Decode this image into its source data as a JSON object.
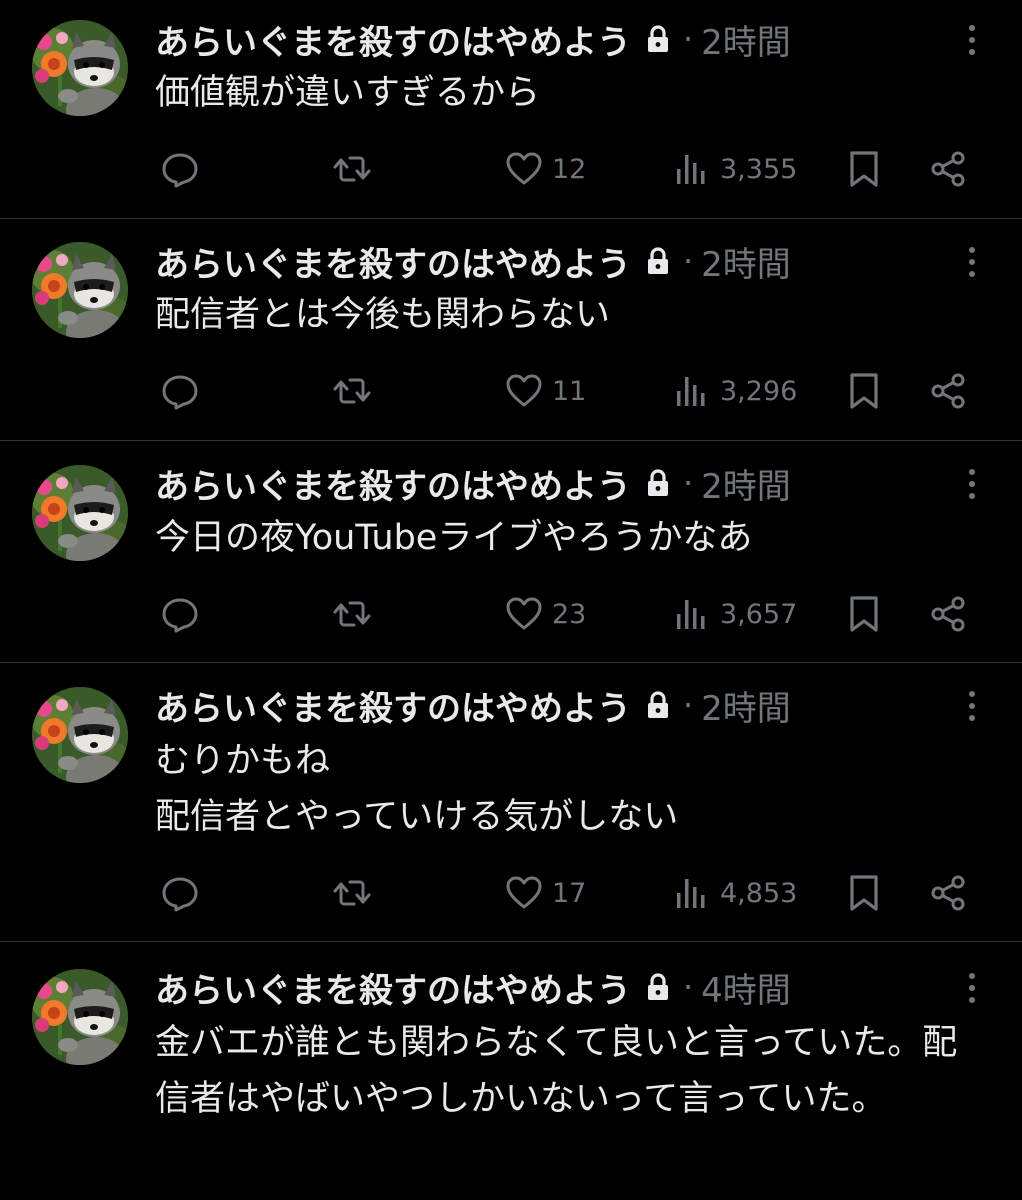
{
  "posts": [
    {
      "author": "あらいぐまを殺すのはやめよう",
      "time": "2時間",
      "text": "価値観が違いすぎるから",
      "likes": "12",
      "views": "3,355"
    },
    {
      "author": "あらいぐまを殺すのはやめよう",
      "time": "2時間",
      "text": "配信者とは今後も関わらない",
      "likes": "11",
      "views": "3,296"
    },
    {
      "author": "あらいぐまを殺すのはやめよう",
      "time": "2時間",
      "text": "今日の夜YouTubeライブやろうかなあ",
      "likes": "23",
      "views": "3,657"
    },
    {
      "author": "あらいぐまを殺すのはやめよう",
      "time": "2時間",
      "text": "むりかもね\n配信者とやっていける気がしない",
      "likes": "17",
      "views": "4,853"
    },
    {
      "author": "あらいぐまを殺すのはやめよう",
      "time": "4時間",
      "text": "金バエが誰とも関わらなくて良いと言っていた。配信者はやばいやつしかいないって言っていた。"
    }
  ],
  "separator": "·",
  "colors": {
    "background": "#000000",
    "text_primary": "#e7e9ea",
    "text_secondary": "#71767b",
    "divider": "#2f3336"
  },
  "icons": [
    "lock-icon",
    "more-icon",
    "reply-icon",
    "repost-icon",
    "like-icon",
    "views-icon",
    "bookmark-icon",
    "share-icon"
  ]
}
